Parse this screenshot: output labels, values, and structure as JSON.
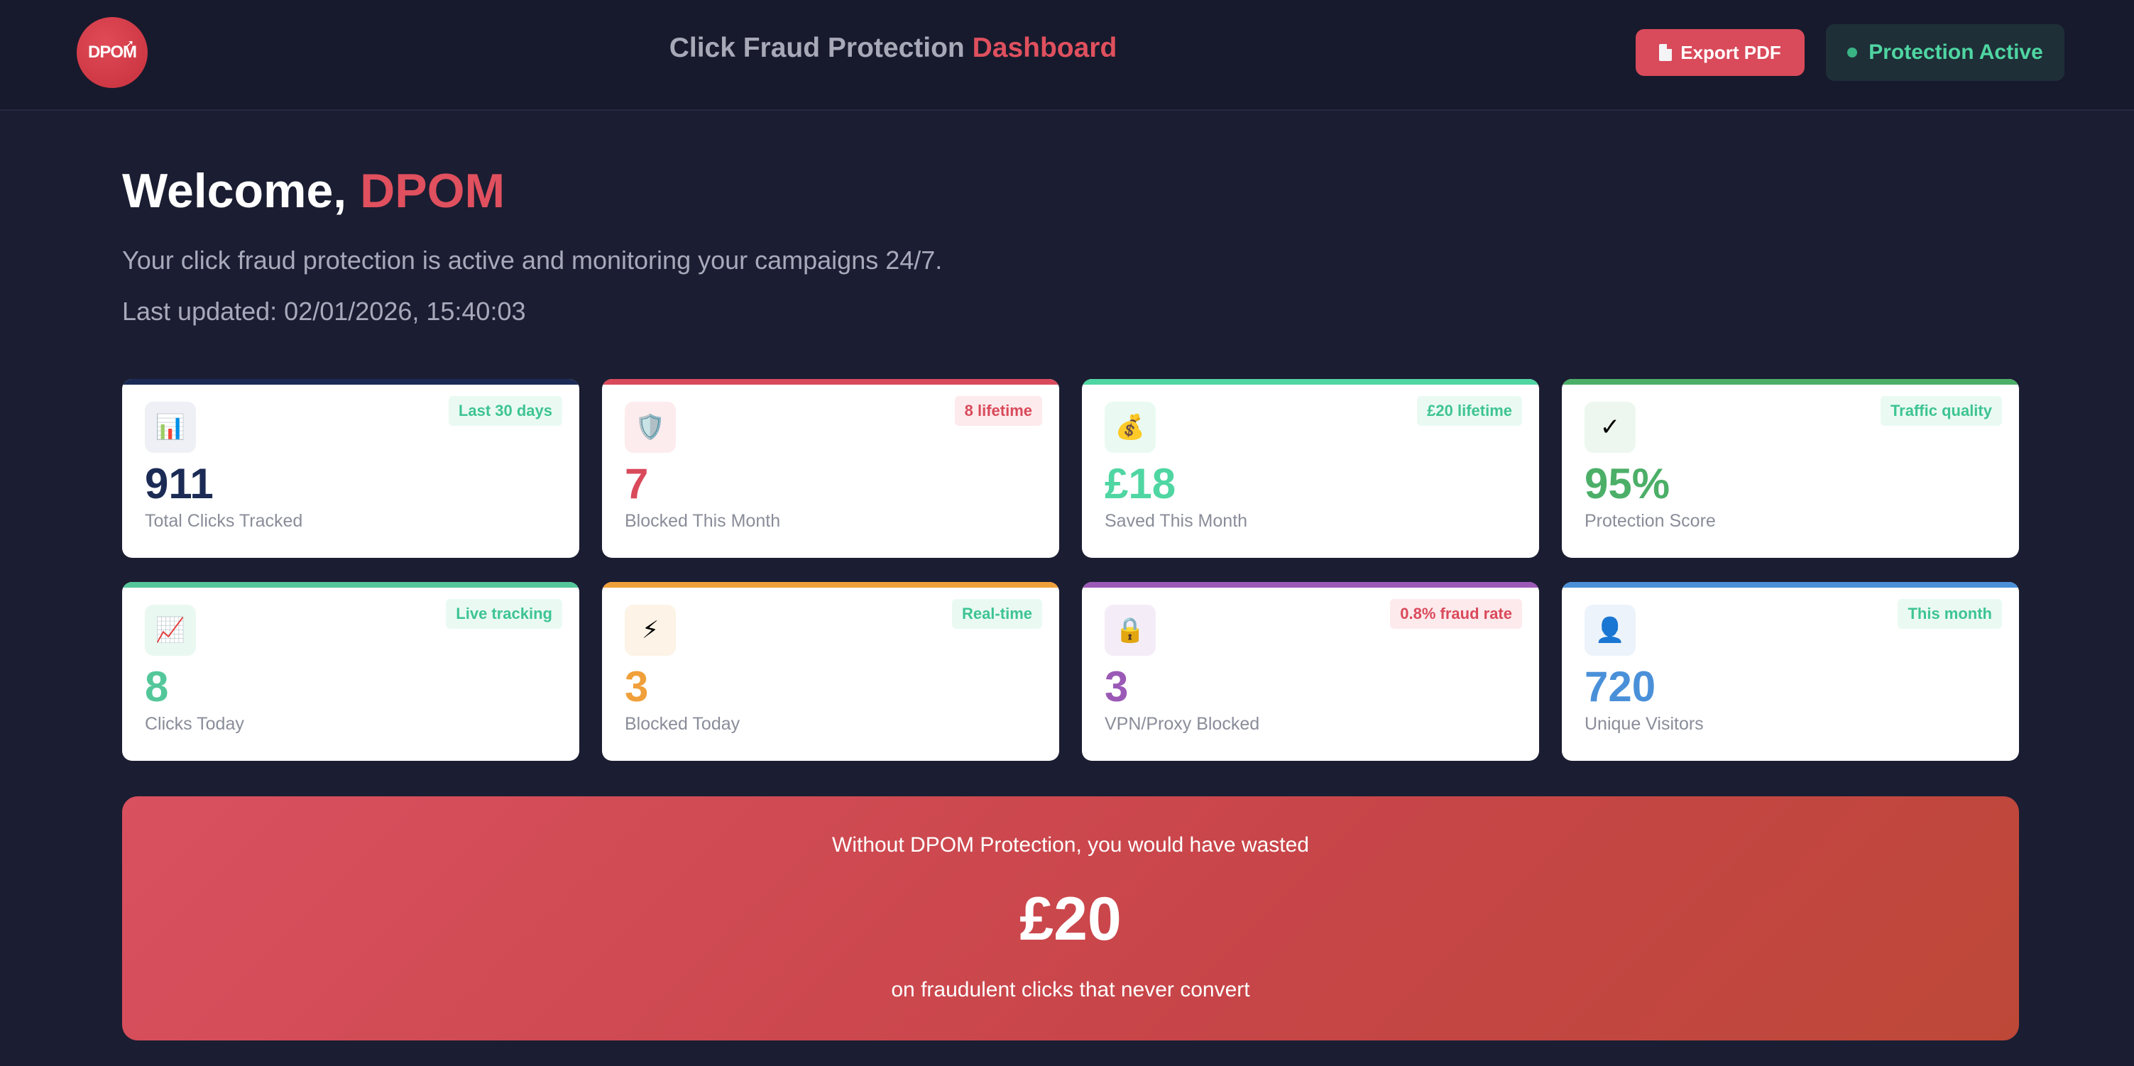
{
  "header": {
    "logo_text": "DPOM",
    "title_main": "Click Fraud Protection",
    "title_accent": "Dashboard",
    "export_label": "Export PDF",
    "status_label": "Protection Active"
  },
  "welcome": {
    "greeting": "Welcome,",
    "name": "DPOM",
    "subtitle": "Your click fraud protection is active and monitoring your campaigns 24/7.",
    "updated": "Last updated: 02/01/2026, 15:40:03"
  },
  "cards": [
    {
      "icon": "bar-chart-icon",
      "glyph": "📊",
      "value": "911",
      "label": "Total Clicks Tracked",
      "badge": "Last 30 days",
      "badge_style": "green",
      "accent": "#1b2b55",
      "value_color": "#1b2b55",
      "icon_bg": "#eef0f5"
    },
    {
      "icon": "shield-icon",
      "glyph": "🛡️",
      "value": "7",
      "label": "Blocked This Month",
      "badge": "8 lifetime",
      "badge_style": "red",
      "accent": "#d94a5b",
      "value_color": "#d94a5b",
      "icon_bg": "#fdecee"
    },
    {
      "icon": "money-bag-icon",
      "glyph": "💰",
      "value": "£18",
      "label": "Saved This Month",
      "badge": "£20 lifetime",
      "badge_style": "green",
      "accent": "#4fd6a2",
      "value_color": "#4fd6a2",
      "icon_bg": "#eafaf3"
    },
    {
      "icon": "check-mark-icon",
      "glyph": "✓",
      "value": "95%",
      "label": "Protection Score",
      "badge": "Traffic quality",
      "badge_style": "green",
      "accent": "#4caf68",
      "value_color": "#4caf68",
      "icon_bg": "#edf7ef"
    },
    {
      "icon": "trend-up-icon",
      "glyph": "📈",
      "value": "8",
      "label": "Clicks Today",
      "badge": "Live tracking",
      "badge_style": "green",
      "accent": "#54c79a",
      "value_color": "#54c79a",
      "icon_bg": "#eaf8f2"
    },
    {
      "icon": "lightning-icon",
      "glyph": "⚡",
      "value": "3",
      "label": "Blocked Today",
      "badge": "Real-time",
      "badge_style": "green",
      "accent": "#f0a03a",
      "value_color": "#f0a03a",
      "icon_bg": "#fdf3e6"
    },
    {
      "icon": "lock-icon",
      "glyph": "🔒",
      "value": "3",
      "label": "VPN/Proxy Blocked",
      "badge": "0.8% fraud rate",
      "badge_style": "red",
      "accent": "#9b59b6",
      "value_color": "#9b59b6",
      "icon_bg": "#f4edf8"
    },
    {
      "icon": "person-icon",
      "glyph": "👤",
      "value": "720",
      "label": "Unique Visitors",
      "badge": "This month",
      "badge_style": "green",
      "accent": "#4a90d9",
      "value_color": "#4a90d9",
      "icon_bg": "#ecf3fb"
    }
  ],
  "banner": {
    "top": "Without DPOM Protection, you would have wasted",
    "amount": "£20",
    "bottom": "on fraudulent clicks that never convert"
  }
}
